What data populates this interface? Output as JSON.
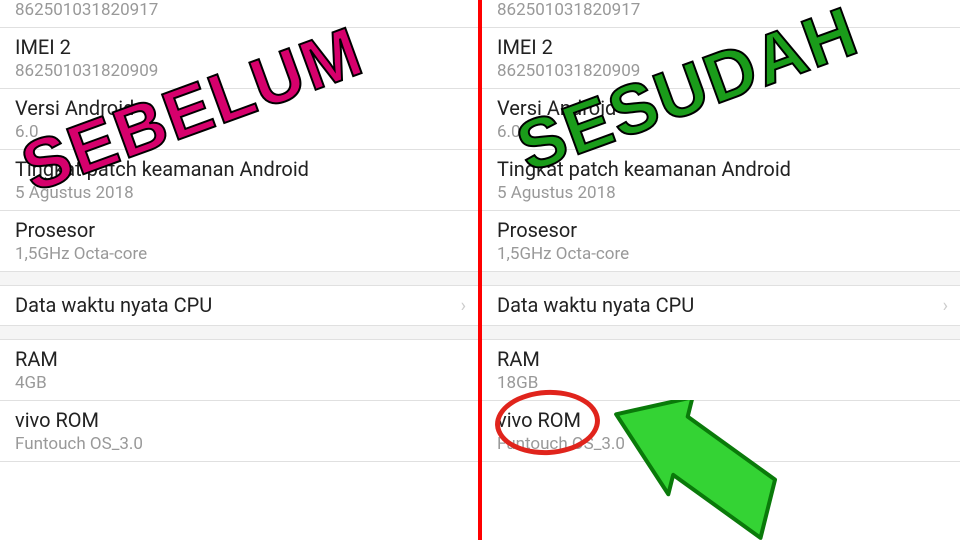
{
  "overlays": {
    "before_label": "SEBELUM",
    "after_label": "SESUDAH"
  },
  "left": {
    "imei1_value": "862501031820917",
    "imei2_label": "IMEI 2",
    "imei2_value": "862501031820909",
    "android_label": "Versi Android",
    "android_value": "6.0",
    "patch_label": "Tingkat patch keamanan Android",
    "patch_value": "5 Agustus 2018",
    "cpu_label": "Prosesor",
    "cpu_value": "1,5GHz Octa-core",
    "realtime_label": "Data waktu nyata CPU",
    "ram_label": "RAM",
    "ram_value": "4GB",
    "rom_label": "vivo ROM",
    "rom_value": "Funtouch OS_3.0"
  },
  "right": {
    "imei1_value": "862501031820917",
    "imei2_label": "IMEI 2",
    "imei2_value": "862501031820909",
    "android_label": "Versi Android",
    "android_value": "6.0",
    "patch_label": "Tingkat patch keamanan Android",
    "patch_value": "5 Agustus 2018",
    "cpu_label": "Prosesor",
    "cpu_value": "1,5GHz Octa-core",
    "realtime_label": "Data waktu nyata CPU",
    "ram_label": "RAM",
    "ram_value": "18GB",
    "rom_label": "vivo ROM",
    "rom_value": "Funtouch OS_3.0"
  }
}
